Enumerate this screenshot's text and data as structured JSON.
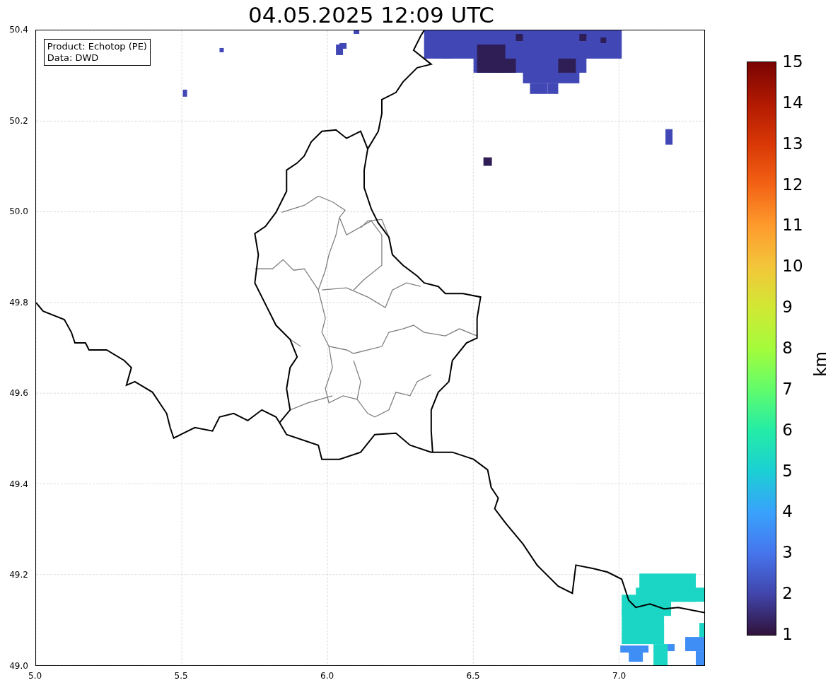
{
  "title": "04.05.2025 12:09 UTC",
  "info_box": [
    "Product: Echotop (PE)",
    "Data: DWD"
  ],
  "map": {
    "x_ticks": [
      "5.0",
      "5.5",
      "6.0",
      "6.5",
      "7.0"
    ],
    "y_ticks": [
      "50.4",
      "50.2",
      "50.0",
      "49.8",
      "49.6",
      "49.4",
      "49.2",
      "49.0"
    ]
  },
  "colorbar": {
    "label": "km",
    "ticks": [
      "15",
      "14",
      "13",
      "12",
      "11",
      "10",
      "9",
      "8",
      "7",
      "6",
      "5",
      "4",
      "3",
      "2",
      "1"
    ]
  }
}
